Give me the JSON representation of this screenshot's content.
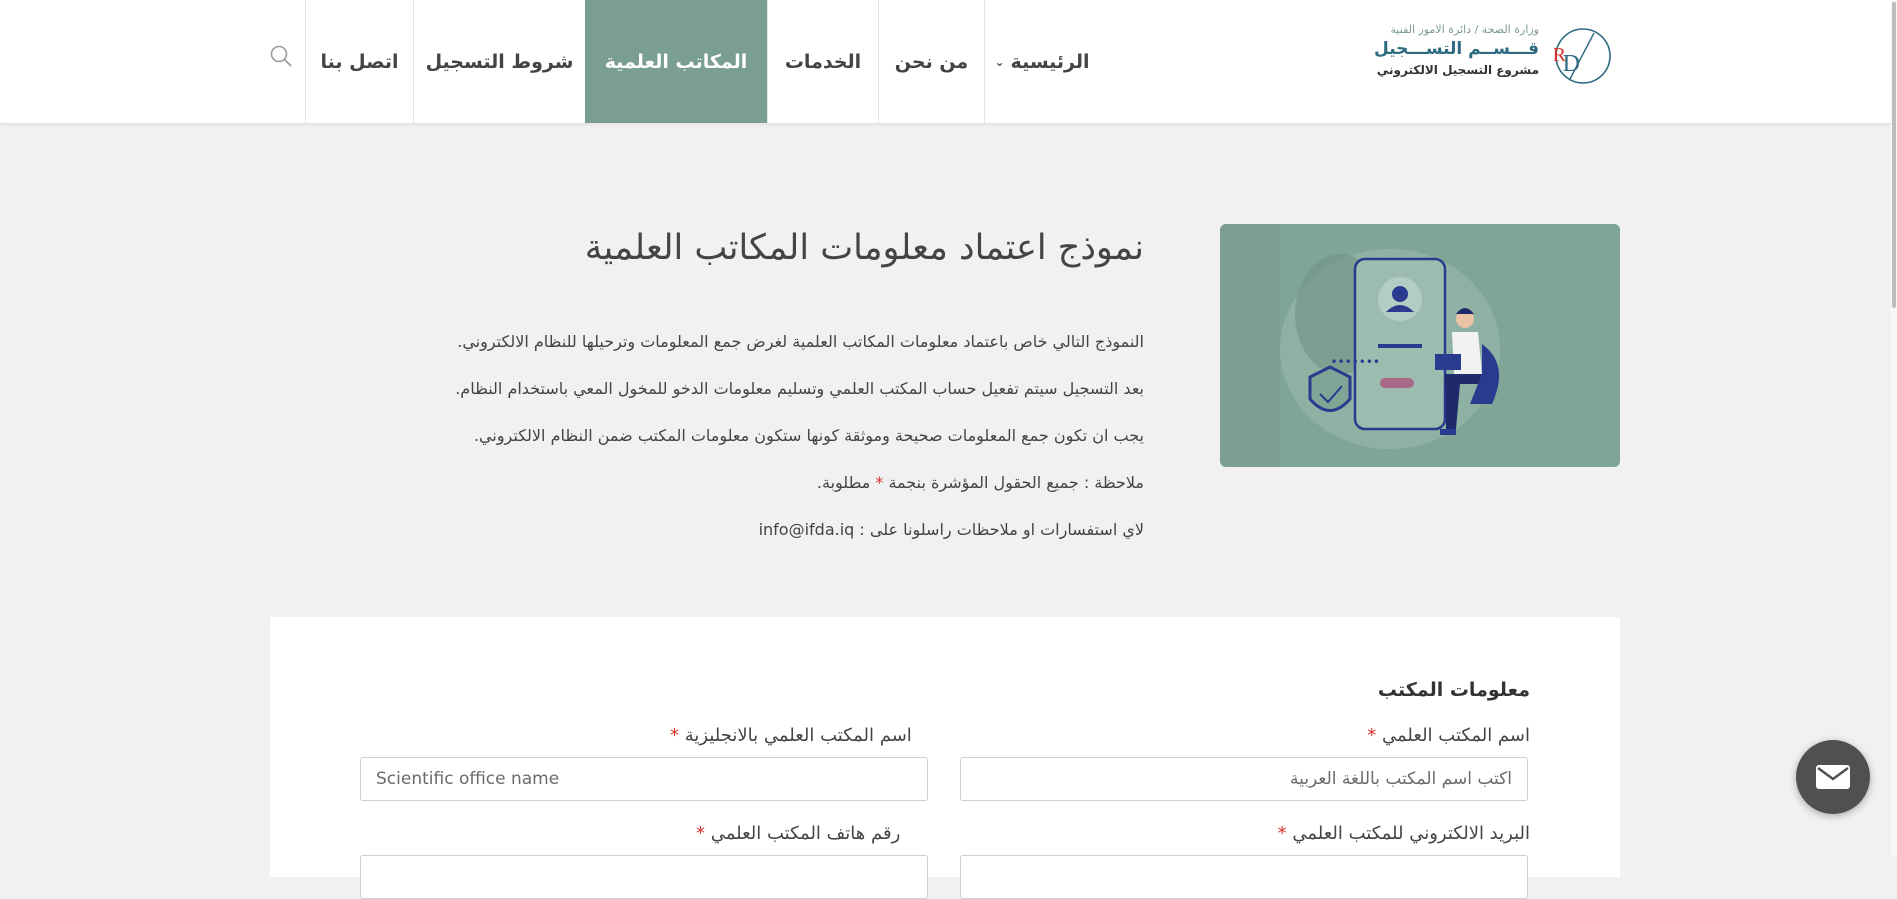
{
  "header": {
    "logo": {
      "ministry": "وزارة الصحة / دائرة الامور الفنية",
      "department": "قـــســم التســـجيل",
      "project": "مشروع التسجيل الالكتروني",
      "mark": "RD"
    },
    "nav": {
      "home": "الرئيسية",
      "about": "من نحن",
      "services": "الخدمات",
      "offices": "المكاتب العلمية",
      "terms": "شروط التسجيل",
      "contact": "اتصل بنا"
    },
    "active_nav": "offices",
    "icons": {
      "search": "search-icon",
      "dropdown": "chevron-down-icon"
    }
  },
  "intro": {
    "title": "نموذج اعتماد معلومات المكاتب العلمية",
    "line1": "النموذج التالي خاص باعتماد معلومات المكاتب العلمية لغرض جمع المعلومات وترحيلها للنظام الالكتروني.",
    "line2": "بعد التسجيل سيتم تفعيل حساب المكتب العلمي وتسليم معلومات الدخو للمخول المعي باستخدام النظام.",
    "line3": "يجب ان تكون جمع المعلومات صحيحة وموثقة كونها ستكون معلومات المكتب ضمن النظام الالكتروني.",
    "note_before": "ملاحظة : جميع الحقول المؤشرة بنجمة ",
    "note_star": "*",
    "note_after": " مطلوبة.",
    "contact_line": "لاي استفسارات او ملاحظات راسلونا على : info@ifda.iq"
  },
  "form": {
    "section_title": "معلومات المكتب",
    "required_mark": "*",
    "fields": {
      "arabic_name": {
        "label": "اسم المكتب العلمي",
        "placeholder": "اكتب اسم المكتب باللغة العربية"
      },
      "english_name": {
        "label": "اسم المكتب العلمي بالانجليزية",
        "placeholder": "Scientific office name"
      },
      "email": {
        "label": "البريد الالكتروني للمكتب العلمي",
        "placeholder": ""
      },
      "phone": {
        "label": "رقم هاتف المكتب العلمي",
        "placeholder": ""
      }
    }
  },
  "fab": {
    "icon": "mail-icon"
  },
  "colors": {
    "accent": "#7a9e90",
    "brand_blue": "#2e6a80",
    "required": "#d9302b",
    "background": "#f1f1f1"
  }
}
